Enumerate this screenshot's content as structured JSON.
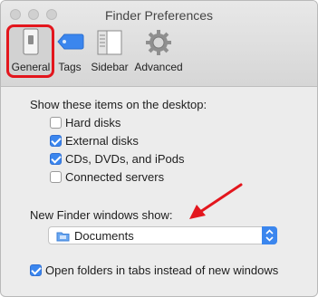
{
  "window": {
    "title": "Finder Preferences"
  },
  "toolbar": {
    "general": "General",
    "tags": "Tags",
    "sidebar": "Sidebar",
    "advanced": "Advanced"
  },
  "desktop": {
    "heading": "Show these items on the desktop:",
    "items": [
      {
        "label": "Hard disks",
        "checked": false
      },
      {
        "label": "External disks",
        "checked": true
      },
      {
        "label": "CDs, DVDs, and iPods",
        "checked": true
      },
      {
        "label": "Connected servers",
        "checked": false
      }
    ]
  },
  "new_window": {
    "heading": "New Finder windows show:",
    "selected": "Documents"
  },
  "tabs_option": {
    "label": "Open folders in tabs instead of new windows",
    "checked": true
  },
  "colors": {
    "accent": "#3b86ee",
    "annotation": "#e3161d"
  }
}
